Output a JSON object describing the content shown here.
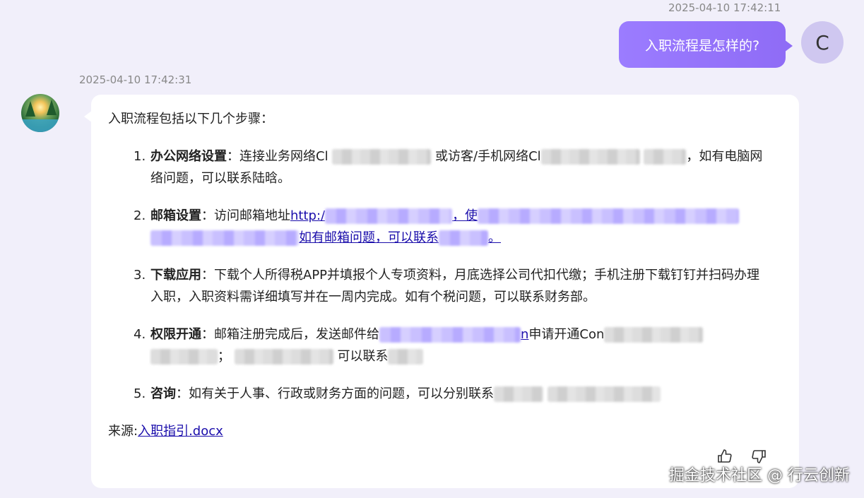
{
  "user_message": {
    "timestamp": "2025-04-10 17:42:11",
    "text": "入职流程是怎样的?",
    "avatar_letter": "C"
  },
  "bot_message": {
    "timestamp": "2025-04-10 17:42:31",
    "intro": "入职流程包括以下几个步骤：",
    "steps": [
      {
        "num": "1.",
        "title": "办公网络设置",
        "colon": "：",
        "part1": "连接业务网络Cl",
        "part2": "或访客/手机网络Cl",
        "part3": "，如有电脑网络问题，可以联系陆晗。"
      },
      {
        "num": "2.",
        "title": "邮箱设置",
        "colon": "：",
        "part1": "访问邮箱地址",
        "link1": "http:/",
        "link2": "，使",
        "link3": "如有邮箱问题，可以联系",
        "link4": "。"
      },
      {
        "num": "3.",
        "title": "下载应用",
        "colon": "：",
        "text": "下载个人所得税APP并填报个人专项资料，月底选择公司代扣代缴；手机注册下载钉钉并扫码办理入职，入职资料需详细填写并在一周内完成。如有个税问题，可以联系财务部。"
      },
      {
        "num": "4.",
        "title": "权限开通",
        "colon": "：",
        "part1": "邮箱注册完成后，发送邮件给",
        "link_end": "n",
        "part2": "申请开通Con",
        "part3": "；",
        "part4": "可以联系"
      },
      {
        "num": "5.",
        "title": "咨询",
        "colon": "：",
        "text": "如有关于人事、行政或财务方面的问题，可以分别联系"
      }
    ],
    "source_label": "来源:",
    "source_link": "入职指引.docx"
  },
  "feedback": {
    "like_icon": "thumbs-up-icon",
    "dislike_icon": "thumbs-down-icon"
  },
  "watermark": "掘金技术社区 @ 行云创新"
}
